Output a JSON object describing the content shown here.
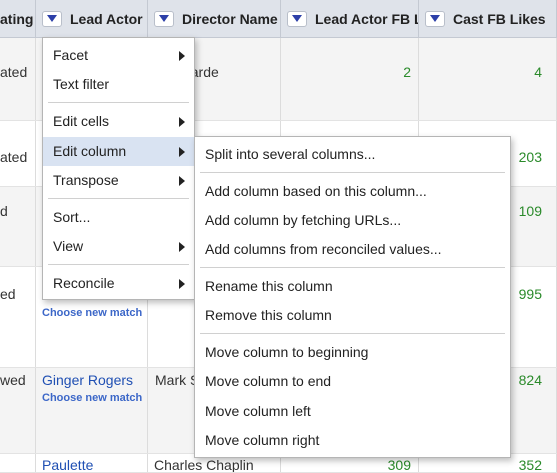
{
  "columns": [
    {
      "label": "ating"
    },
    {
      "label": "Lead Actor"
    },
    {
      "label": "Director Name"
    },
    {
      "label": "Lead Actor FB L"
    },
    {
      "label": "Cast FB Likes"
    }
  ],
  "rows": [
    {
      "rating": "ated",
      "actor": "",
      "match": "",
      "director": "F. Millarde",
      "actor_likes": "2",
      "cast_likes": "4"
    },
    {
      "rating": "ated",
      "actor": "",
      "match": "",
      "director": "",
      "actor_likes": "",
      "cast_likes": "203"
    },
    {
      "rating": "d",
      "actor": "",
      "match": "",
      "director": "",
      "actor_likes": "",
      "cast_likes": "109"
    },
    {
      "rating": "ed",
      "actor": "",
      "match": "Choose new match",
      "director": "",
      "actor_likes": "",
      "cast_likes": "995"
    },
    {
      "rating": "wed",
      "actor": "Ginger Rogers",
      "match": "Choose new match",
      "director": "Mark S",
      "actor_likes": "",
      "cast_likes": "824"
    },
    {
      "rating": "",
      "actor": "Paulette",
      "match": "",
      "director": "Charles Chaplin",
      "actor_likes": "309",
      "cast_likes": "352"
    }
  ],
  "column_menu": {
    "items": [
      {
        "label": "Facet",
        "submenu": true
      },
      {
        "label": "Text filter",
        "submenu": false
      },
      {
        "label": "Edit cells",
        "submenu": true
      },
      {
        "label": "Edit column",
        "submenu": true
      },
      {
        "label": "Transpose",
        "submenu": true
      },
      {
        "label": "Sort...",
        "submenu": false
      },
      {
        "label": "View",
        "submenu": true
      },
      {
        "label": "Reconcile",
        "submenu": true
      }
    ],
    "active_item": "Edit column"
  },
  "edit_column_submenu": {
    "items": [
      {
        "label": "Split into several columns..."
      },
      {
        "label": "Add column based on this column..."
      },
      {
        "label": "Add column by fetching URLs..."
      },
      {
        "label": "Add columns from reconciled values..."
      },
      {
        "label": "Rename this column"
      },
      {
        "label": "Remove this column"
      },
      {
        "label": "Move column to beginning"
      },
      {
        "label": "Move column to end"
      },
      {
        "label": "Move column left"
      },
      {
        "label": "Move column right"
      }
    ]
  },
  "colors": {
    "header_bg": "#dfe3ea",
    "active_menu_bg": "#d9e3f2",
    "number_green": "#2a8a2a",
    "link_blue": "#1f4fb3"
  }
}
